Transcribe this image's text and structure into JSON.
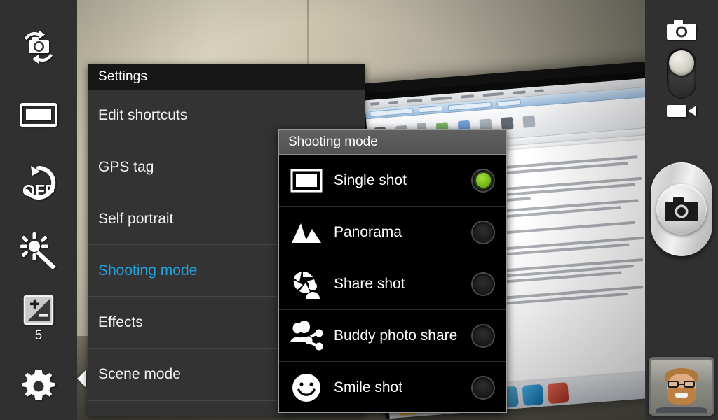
{
  "left_toolbar": {
    "items": [
      {
        "name": "switch-camera",
        "icon": "switch-camera-icon",
        "value": null
      },
      {
        "name": "shooting-mode-shortcut",
        "icon": "single-shot-frame-icon",
        "value": null
      },
      {
        "name": "timer",
        "icon": "timer-off-icon",
        "value": "OFF"
      },
      {
        "name": "effects",
        "icon": "magic-wand-icon",
        "value": null
      },
      {
        "name": "exposure-value",
        "icon": "exposure-icon",
        "value": "5"
      },
      {
        "name": "settings",
        "icon": "gear-icon",
        "value": null
      }
    ],
    "collapse_arrow": "collapse-panel-arrow"
  },
  "right_toolbar": {
    "mode_toggle": {
      "camera_icon": "camera-icon",
      "video_icon": "video-camera-icon",
      "selected": "camera"
    },
    "shutter": {
      "icon": "camera-icon",
      "label": "Shutter"
    },
    "thumbnail": {
      "label": "Last photo preview"
    }
  },
  "settings_panel": {
    "title": "Settings",
    "rows": [
      {
        "label": "Edit shortcuts",
        "value": "",
        "selected": false
      },
      {
        "label": "GPS tag",
        "value": "",
        "selected": false
      },
      {
        "label": "Self portrait",
        "value": "",
        "selected": false
      },
      {
        "label": "Shooting mode",
        "value": "Single shot",
        "selected": true
      },
      {
        "label": "Effects",
        "value": "",
        "selected": false
      },
      {
        "label": "Scene mode",
        "value": "",
        "selected": false
      }
    ]
  },
  "submenu": {
    "title": "Shooting mode",
    "options": [
      {
        "label": "Single shot",
        "icon": "single-shot-frame-icon",
        "selected": true
      },
      {
        "label": "Panorama",
        "icon": "panorama-mountains-icon",
        "selected": false
      },
      {
        "label": "Share shot",
        "icon": "aperture-person-icon",
        "selected": false
      },
      {
        "label": "Buddy photo share",
        "icon": "buddy-share-people-icon",
        "selected": false
      },
      {
        "label": "Smile shot",
        "icon": "smiley-face-icon",
        "selected": false
      }
    ]
  },
  "colors": {
    "accent_blue": "#22a3e2",
    "radio_green": "#7dc220",
    "panel_bg": "#333333",
    "panel_header": "#171717",
    "submenu_bg": "#000000",
    "submenu_header": "#5a5a5a",
    "toolbar_bg": "#303030"
  }
}
